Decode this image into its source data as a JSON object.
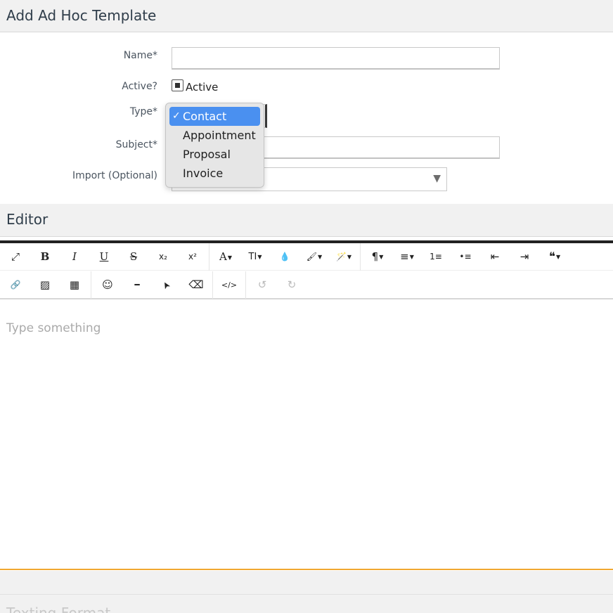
{
  "page": {
    "title": "Add Ad Hoc Template"
  },
  "form": {
    "name_label": "Name*",
    "name_value": "",
    "active_label": "Active?",
    "active_checkbox_text": "Active",
    "active_checked": true,
    "type_label": "Type*",
    "subject_label": "Subject*",
    "subject_value": "",
    "import_label": "Import (Optional)",
    "import_value": "",
    "import_arrow": "▼"
  },
  "type_menu": {
    "check": "✓",
    "options": [
      "Contact",
      "Appointment",
      "Proposal",
      "Invoice"
    ],
    "selected": "Contact"
  },
  "editor": {
    "section_title": "Editor",
    "placeholder": "Type something",
    "accent_color": "#f0a830",
    "toolbar_row1": [
      {
        "name": "fullscreen-icon",
        "glyph": "⤢"
      },
      {
        "name": "bold-icon",
        "glyph": "B"
      },
      {
        "name": "italic-icon",
        "glyph": "I"
      },
      {
        "name": "underline-icon",
        "glyph": "U"
      },
      {
        "name": "strikethrough-icon",
        "glyph": "S"
      },
      {
        "name": "subscript-icon",
        "glyph": "x₂"
      },
      {
        "name": "superscript-icon",
        "glyph": "x²"
      },
      {
        "name": "font-family-icon",
        "glyph": "A"
      },
      {
        "name": "font-size-icon",
        "glyph": "TI"
      },
      {
        "name": "color-drop-icon",
        "glyph": "💧"
      },
      {
        "name": "paint-brush-icon",
        "glyph": "🖌"
      },
      {
        "name": "magic-wand-icon",
        "glyph": "🪄"
      },
      {
        "name": "paragraph-icon",
        "glyph": "¶"
      },
      {
        "name": "align-icon",
        "glyph": "≡"
      },
      {
        "name": "ordered-list-icon",
        "glyph": "1≡"
      },
      {
        "name": "unordered-list-icon",
        "glyph": "•≡"
      },
      {
        "name": "outdent-icon",
        "glyph": "⇤"
      },
      {
        "name": "indent-icon",
        "glyph": "⇥"
      },
      {
        "name": "quote-icon",
        "glyph": "❝"
      }
    ],
    "toolbar_row2": [
      {
        "name": "link-icon",
        "glyph": "🔗"
      },
      {
        "name": "image-icon",
        "glyph": "▨"
      },
      {
        "name": "table-icon",
        "glyph": "▦"
      },
      {
        "name": "emoji-icon",
        "glyph": "☺"
      },
      {
        "name": "horizontal-rule-icon",
        "glyph": "━"
      },
      {
        "name": "pointer-icon",
        "glyph": "➤"
      },
      {
        "name": "eraser-icon",
        "glyph": "⌫"
      },
      {
        "name": "code-view-icon",
        "glyph": "</>"
      },
      {
        "name": "undo-icon",
        "glyph": "↺"
      },
      {
        "name": "redo-icon",
        "glyph": "↻"
      }
    ]
  },
  "texting": {
    "section_title": "Texting Format"
  }
}
